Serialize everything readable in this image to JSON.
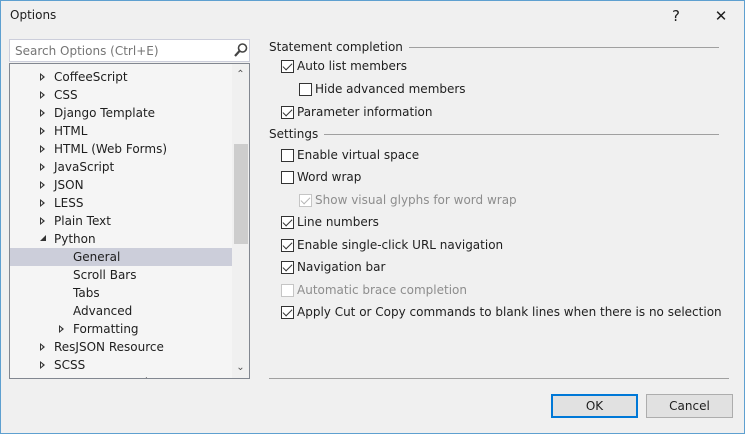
{
  "window": {
    "title": "Options",
    "help": "?",
    "close": "✕"
  },
  "search": {
    "placeholder": "Search Options (Ctrl+E)"
  },
  "tree": [
    {
      "label": "CoffeeScript",
      "level": 0,
      "arrow": "collapsed"
    },
    {
      "label": "CSS",
      "level": 0,
      "arrow": "collapsed"
    },
    {
      "label": "Django Template",
      "level": 0,
      "arrow": "collapsed"
    },
    {
      "label": "HTML",
      "level": 0,
      "arrow": "collapsed"
    },
    {
      "label": "HTML (Web Forms)",
      "level": 0,
      "arrow": "collapsed"
    },
    {
      "label": "JavaScript",
      "level": 0,
      "arrow": "collapsed"
    },
    {
      "label": "JSON",
      "level": 0,
      "arrow": "collapsed"
    },
    {
      "label": "LESS",
      "level": 0,
      "arrow": "collapsed"
    },
    {
      "label": "Plain Text",
      "level": 0,
      "arrow": "collapsed"
    },
    {
      "label": "Python",
      "level": 0,
      "arrow": "expanded"
    },
    {
      "label": "General",
      "level": 1,
      "arrow": "none",
      "selected": true
    },
    {
      "label": "Scroll Bars",
      "level": 1,
      "arrow": "none"
    },
    {
      "label": "Tabs",
      "level": 1,
      "arrow": "none"
    },
    {
      "label": "Advanced",
      "level": 1,
      "arrow": "none"
    },
    {
      "label": "Formatting",
      "level": 1,
      "arrow": "collapsed"
    },
    {
      "label": "ResJSON Resource",
      "level": 0,
      "arrow": "collapsed"
    },
    {
      "label": "SCSS",
      "level": 0,
      "arrow": "collapsed"
    },
    {
      "label": "SQL Server Tools",
      "level": 0,
      "arrow": "collapsed"
    }
  ],
  "groups": {
    "statement": "Statement completion",
    "settings": "Settings"
  },
  "options": [
    {
      "label": "Auto list members",
      "checked": true,
      "disabled": false,
      "indent": false,
      "group": "statement"
    },
    {
      "label": "Hide advanced members",
      "checked": false,
      "disabled": false,
      "indent": true,
      "group": "statement"
    },
    {
      "label": "Parameter information",
      "checked": true,
      "disabled": false,
      "indent": false,
      "group": "statement"
    },
    {
      "label": "Enable virtual space",
      "checked": false,
      "disabled": false,
      "indent": false,
      "group": "settings"
    },
    {
      "label": "Word wrap",
      "checked": false,
      "disabled": false,
      "indent": false,
      "group": "settings"
    },
    {
      "label": "Show visual glyphs for word wrap",
      "checked": true,
      "disabled": true,
      "indent": true,
      "group": "settings"
    },
    {
      "label": "Line numbers",
      "checked": true,
      "disabled": false,
      "indent": false,
      "group": "settings"
    },
    {
      "label": "Enable single-click URL navigation",
      "checked": true,
      "disabled": false,
      "indent": false,
      "group": "settings"
    },
    {
      "label": "Navigation bar",
      "checked": true,
      "disabled": false,
      "indent": false,
      "group": "settings"
    },
    {
      "label": "Automatic brace completion",
      "checked": false,
      "disabled": true,
      "indent": false,
      "group": "settings"
    },
    {
      "label": "Apply Cut or Copy commands to blank lines when there is no selection",
      "checked": true,
      "disabled": false,
      "indent": false,
      "group": "settings"
    }
  ],
  "buttons": {
    "ok": "OK",
    "cancel": "Cancel"
  }
}
